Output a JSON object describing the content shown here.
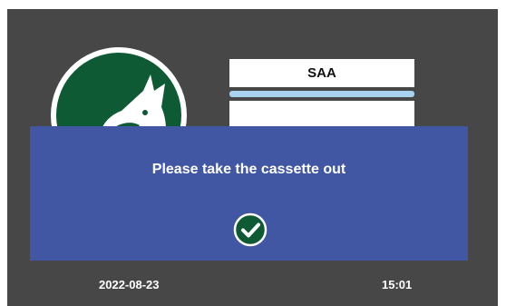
{
  "test": {
    "name": "SAA"
  },
  "dialog": {
    "message": "Please take the cassette out",
    "confirm_icon": "check-circle-icon"
  },
  "footer": {
    "date": "2022-08-23",
    "time": "15:01"
  },
  "colors": {
    "screen_background": "#474747",
    "dialog_background": "#4257a4",
    "logo_green": "#0e5a34",
    "progress_blue": "#a9d2ee",
    "confirm_icon": "#0e5a34"
  }
}
